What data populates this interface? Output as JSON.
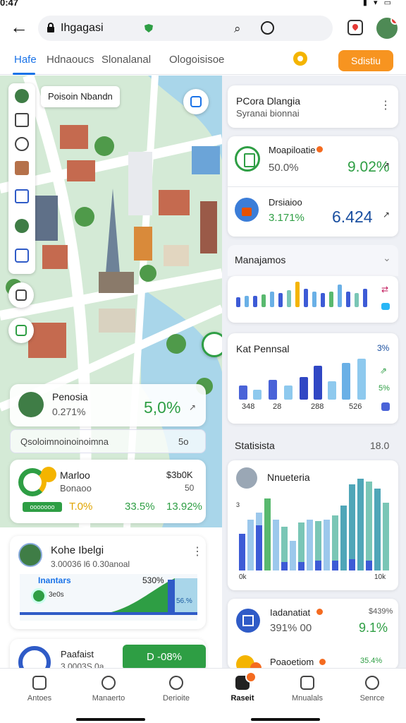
{
  "status": {
    "time": "0:47",
    "icons": "▮ ▾ ▭"
  },
  "browser": {
    "url_text": "Ihgagasi"
  },
  "tabs": [
    {
      "label": "Hafe",
      "active": true
    },
    {
      "label": "Hdnaoucs",
      "active": false
    },
    {
      "label": "Slonalanal",
      "active": false
    },
    {
      "label": "Ologoisisoe",
      "active": false
    }
  ],
  "cta_label": "Sdistiu",
  "map": {
    "label": "Poisoin Nbandn"
  },
  "left_cards": {
    "profile": {
      "name": "Penosia",
      "sub": "0.271%",
      "value": "5,0%"
    },
    "banner": {
      "text": "Qsoloimnoinoinoimna",
      "right": "5o"
    },
    "metric": {
      "title": "Marloo",
      "sub": "Bonaoo",
      "top_right": "$3b0K",
      "top_right_sub": "50",
      "pill": "ooooooo",
      "v1": "T.0%",
      "v2": "33.5%",
      "v3": "13.92%"
    },
    "chart_card": {
      "title": "Kohe Ibelgi",
      "sub": "3.00036 l6 0.30anoal",
      "chart_label": "Inantars",
      "chart_sub": "3e0s",
      "v1": "530%",
      "v2": "56.%"
    },
    "bottom": {
      "title": "Paafaist",
      "sub": "3 0003S 0a",
      "green_value": "D -08%"
    }
  },
  "right": {
    "header": {
      "title": "PCora Dlangia",
      "sub": "Syranai bionnai"
    },
    "row1": {
      "title": "Moapiloatie",
      "sub": "50.0%",
      "value": "9.02%"
    },
    "row2": {
      "title": "Drsiaioo",
      "sub": "3.171%",
      "value": "6.424"
    },
    "section1": "Manajamos",
    "section2": {
      "title": "Kat Pennsal",
      "p1": "3%",
      "p2": "5%",
      "xlabels": [
        "348",
        "28",
        "288",
        "526"
      ]
    },
    "section3": {
      "title": "Statisista",
      "value": "18.0"
    },
    "big_chart": {
      "title": "Nnueteria",
      "ylabel": "3",
      "x_start": "0k",
      "x_end": "10k"
    },
    "row3": {
      "title": "Iadanatiat",
      "sub": "391% 00",
      "tr": "$439%",
      "value": "9.1%"
    },
    "row4": {
      "title": "Poaoetiom",
      "tr": "35.4%"
    }
  },
  "nav": [
    {
      "label": "Antoes",
      "active": false
    },
    {
      "label": "Manaerto",
      "active": false
    },
    {
      "label": "Derioite",
      "active": false
    },
    {
      "label": "Raseit",
      "active": true
    },
    {
      "label": "Mnualals",
      "active": false
    },
    {
      "label": "Senrce",
      "active": false
    }
  ],
  "colors": {
    "accent": "#1a73e8",
    "green": "#2e9e44",
    "orange": "#f79420",
    "navy": "#2f5bc7"
  }
}
